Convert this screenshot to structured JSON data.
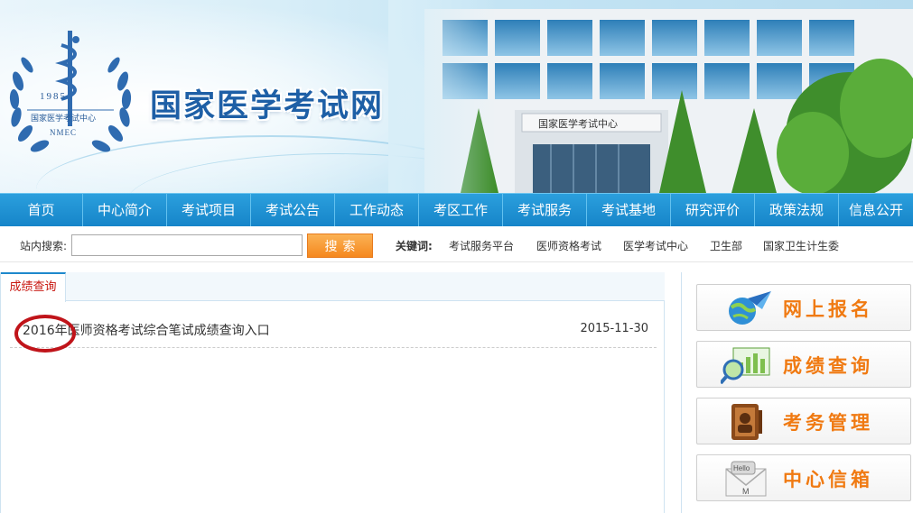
{
  "site": {
    "title": "国家医学考试网",
    "logo_year": "1985",
    "logo_org": "国家医学考试中心",
    "logo_abbr": "NMEC",
    "building_sign": "国家医学考试中心"
  },
  "nav": {
    "items": [
      "首页",
      "中心简介",
      "考试项目",
      "考试公告",
      "工作动态",
      "考区工作",
      "考试服务",
      "考试基地",
      "研究评价",
      "政策法规",
      "信息公开"
    ]
  },
  "search": {
    "label": "站内搜索:",
    "value": "",
    "button": "搜索",
    "keywords_label": "关键词:",
    "keywords": [
      "考试服务平台",
      "医师资格考试",
      "医学考试中心",
      "卫生部",
      "国家卫生计生委"
    ]
  },
  "main": {
    "tab_label": "成绩查询",
    "news": [
      {
        "title": "2016年医师资格考试综合笔试成绩查询入口",
        "date": "2015-11-30"
      }
    ]
  },
  "side": {
    "buttons": [
      {
        "label": "网上报名",
        "icon": "globe-plane-icon"
      },
      {
        "label": "成绩查询",
        "icon": "chart-magnifier-icon"
      },
      {
        "label": "考务管理",
        "icon": "address-book-icon"
      },
      {
        "label": "中心信箱",
        "icon": "hello-mail-icon"
      }
    ]
  },
  "colors": {
    "nav": "#1e8fd3",
    "title": "#1e5fa6",
    "accent": "#f07a12",
    "tab_text": "#c8160f",
    "annotation": "#c0141a"
  }
}
